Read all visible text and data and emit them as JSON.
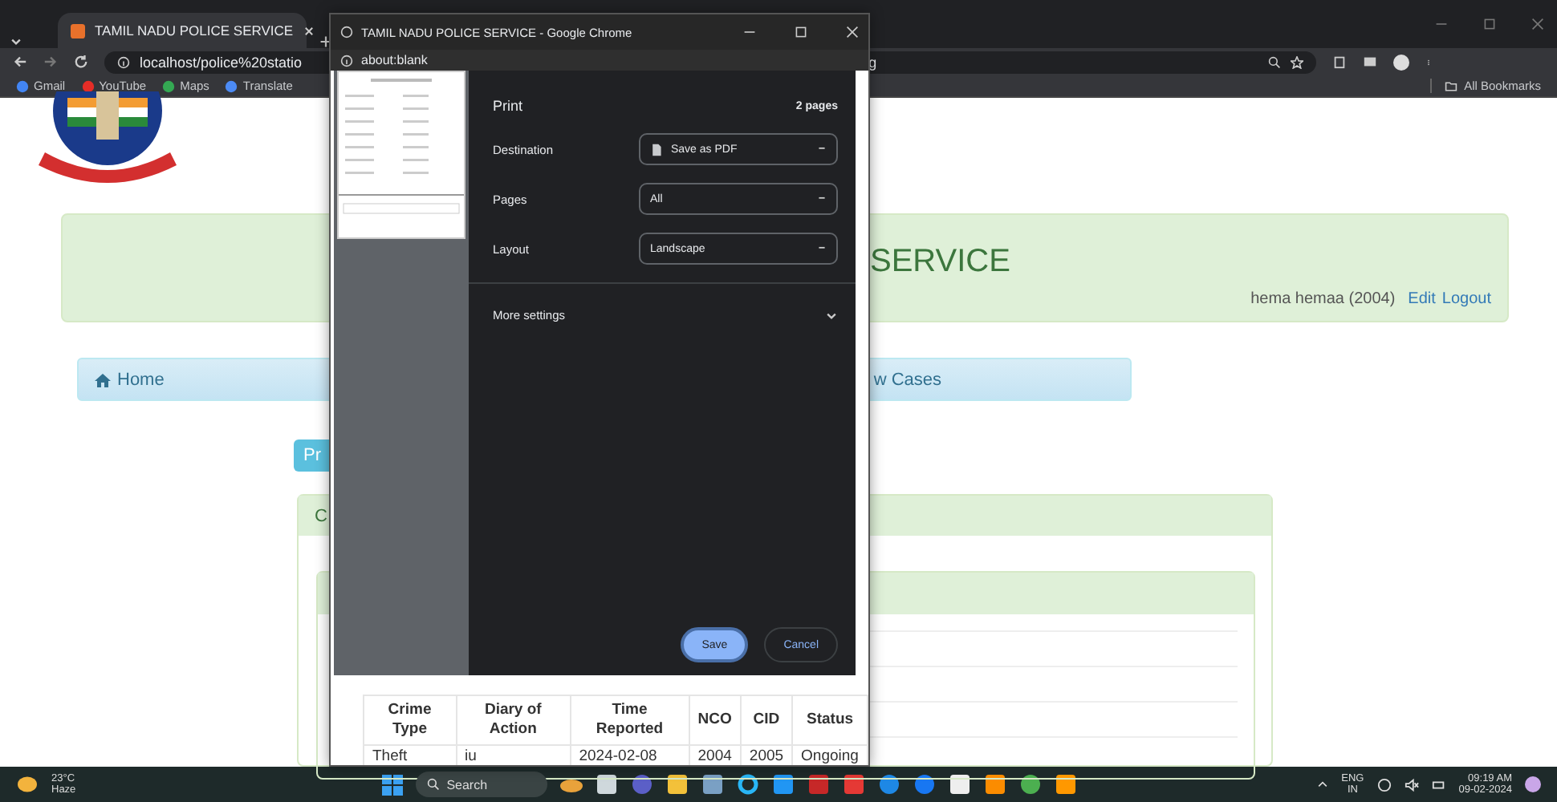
{
  "browser": {
    "tabs": [
      {
        "title": "TAMIL NADU POLICE SERVICE",
        "selected": true
      }
    ],
    "address": "localhost/police%20statio",
    "address_tail": "g",
    "bookmarks": [
      "Gmail",
      "YouTube",
      "Maps",
      "Translate"
    ],
    "all_bookmarks": "All Bookmarks"
  },
  "page": {
    "title": "SERVICE",
    "user": "hema hemaa (2004)",
    "links": [
      "Edit",
      "Logout"
    ],
    "nav": [
      {
        "label": "Home"
      },
      {
        "label": "w Cases"
      }
    ],
    "button": "Pr",
    "panel_title": "C"
  },
  "popup": {
    "title": "TAMIL NADU POLICE SERVICE - Google Chrome",
    "address": "about:blank",
    "print": {
      "title": "Print",
      "pages_count": "2 pages",
      "fields": [
        {
          "label": "Destination",
          "value": "Save as PDF"
        },
        {
          "label": "Pages",
          "value": "All"
        },
        {
          "label": "Layout",
          "value": "Landscape"
        }
      ],
      "more_settings": "More settings",
      "buttons": [
        {
          "label": "Save",
          "kind": "primary"
        },
        {
          "label": "Cancel",
          "kind": "secondary"
        }
      ]
    },
    "table": {
      "columns": [
        "Crime Type",
        "Diary of Action",
        "Time Reported",
        "NCO",
        "CID",
        "Status"
      ],
      "rows": [
        [
          "Theft",
          "iu",
          "2024-02-08",
          "2004",
          "2005",
          "Ongoing"
        ]
      ]
    }
  },
  "taskbar": {
    "weather": {
      "temp": "23°C",
      "condition": "Haze"
    },
    "search": {
      "placeholder": "Search"
    },
    "language": [
      "ENG",
      "IN"
    ],
    "time": "09:19 AM",
    "date": "09-02-2024"
  }
}
